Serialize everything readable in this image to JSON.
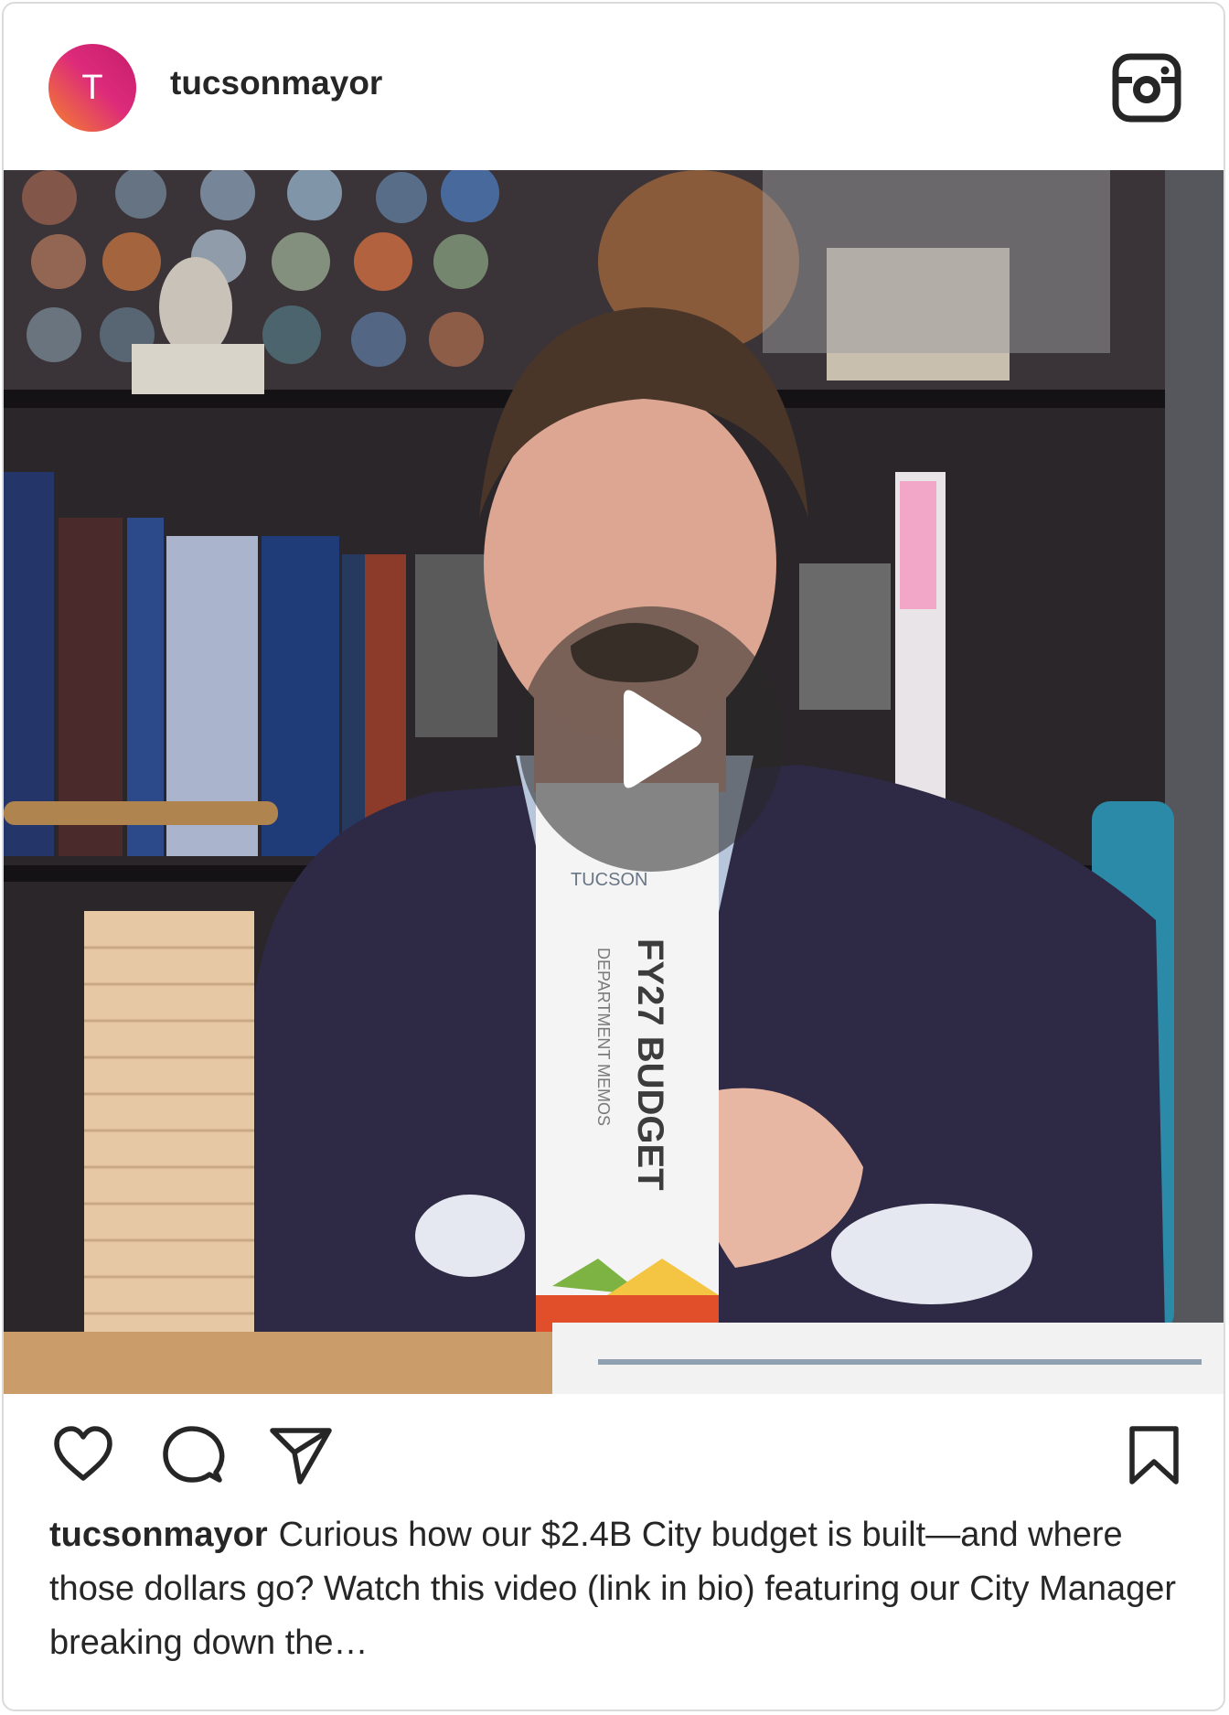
{
  "post": {
    "avatar_letter": "T",
    "username": "tucsonmayor",
    "caption_username": "tucsonmayor",
    "caption_text": "Curious how our $2.4B City budget is built—and where those dollars go? Watch this video (link in bio) featuring our City Manager breaking down the…"
  },
  "video": {
    "box_logo_text": "TUCSON",
    "box_title": "FY27 BUDGET",
    "box_subtitle": "DEPARTMENT MEMOS"
  },
  "icons": {
    "header": "instagram-icon",
    "actions": [
      "heart-icon",
      "comment-icon",
      "share-icon",
      "bookmark-icon"
    ],
    "overlay": "play-icon"
  },
  "colors": {
    "username": "#262626",
    "border": "#dbdbdb",
    "avatar_gradient_start": "#f58529",
    "avatar_gradient_end": "#dd2a7b"
  }
}
